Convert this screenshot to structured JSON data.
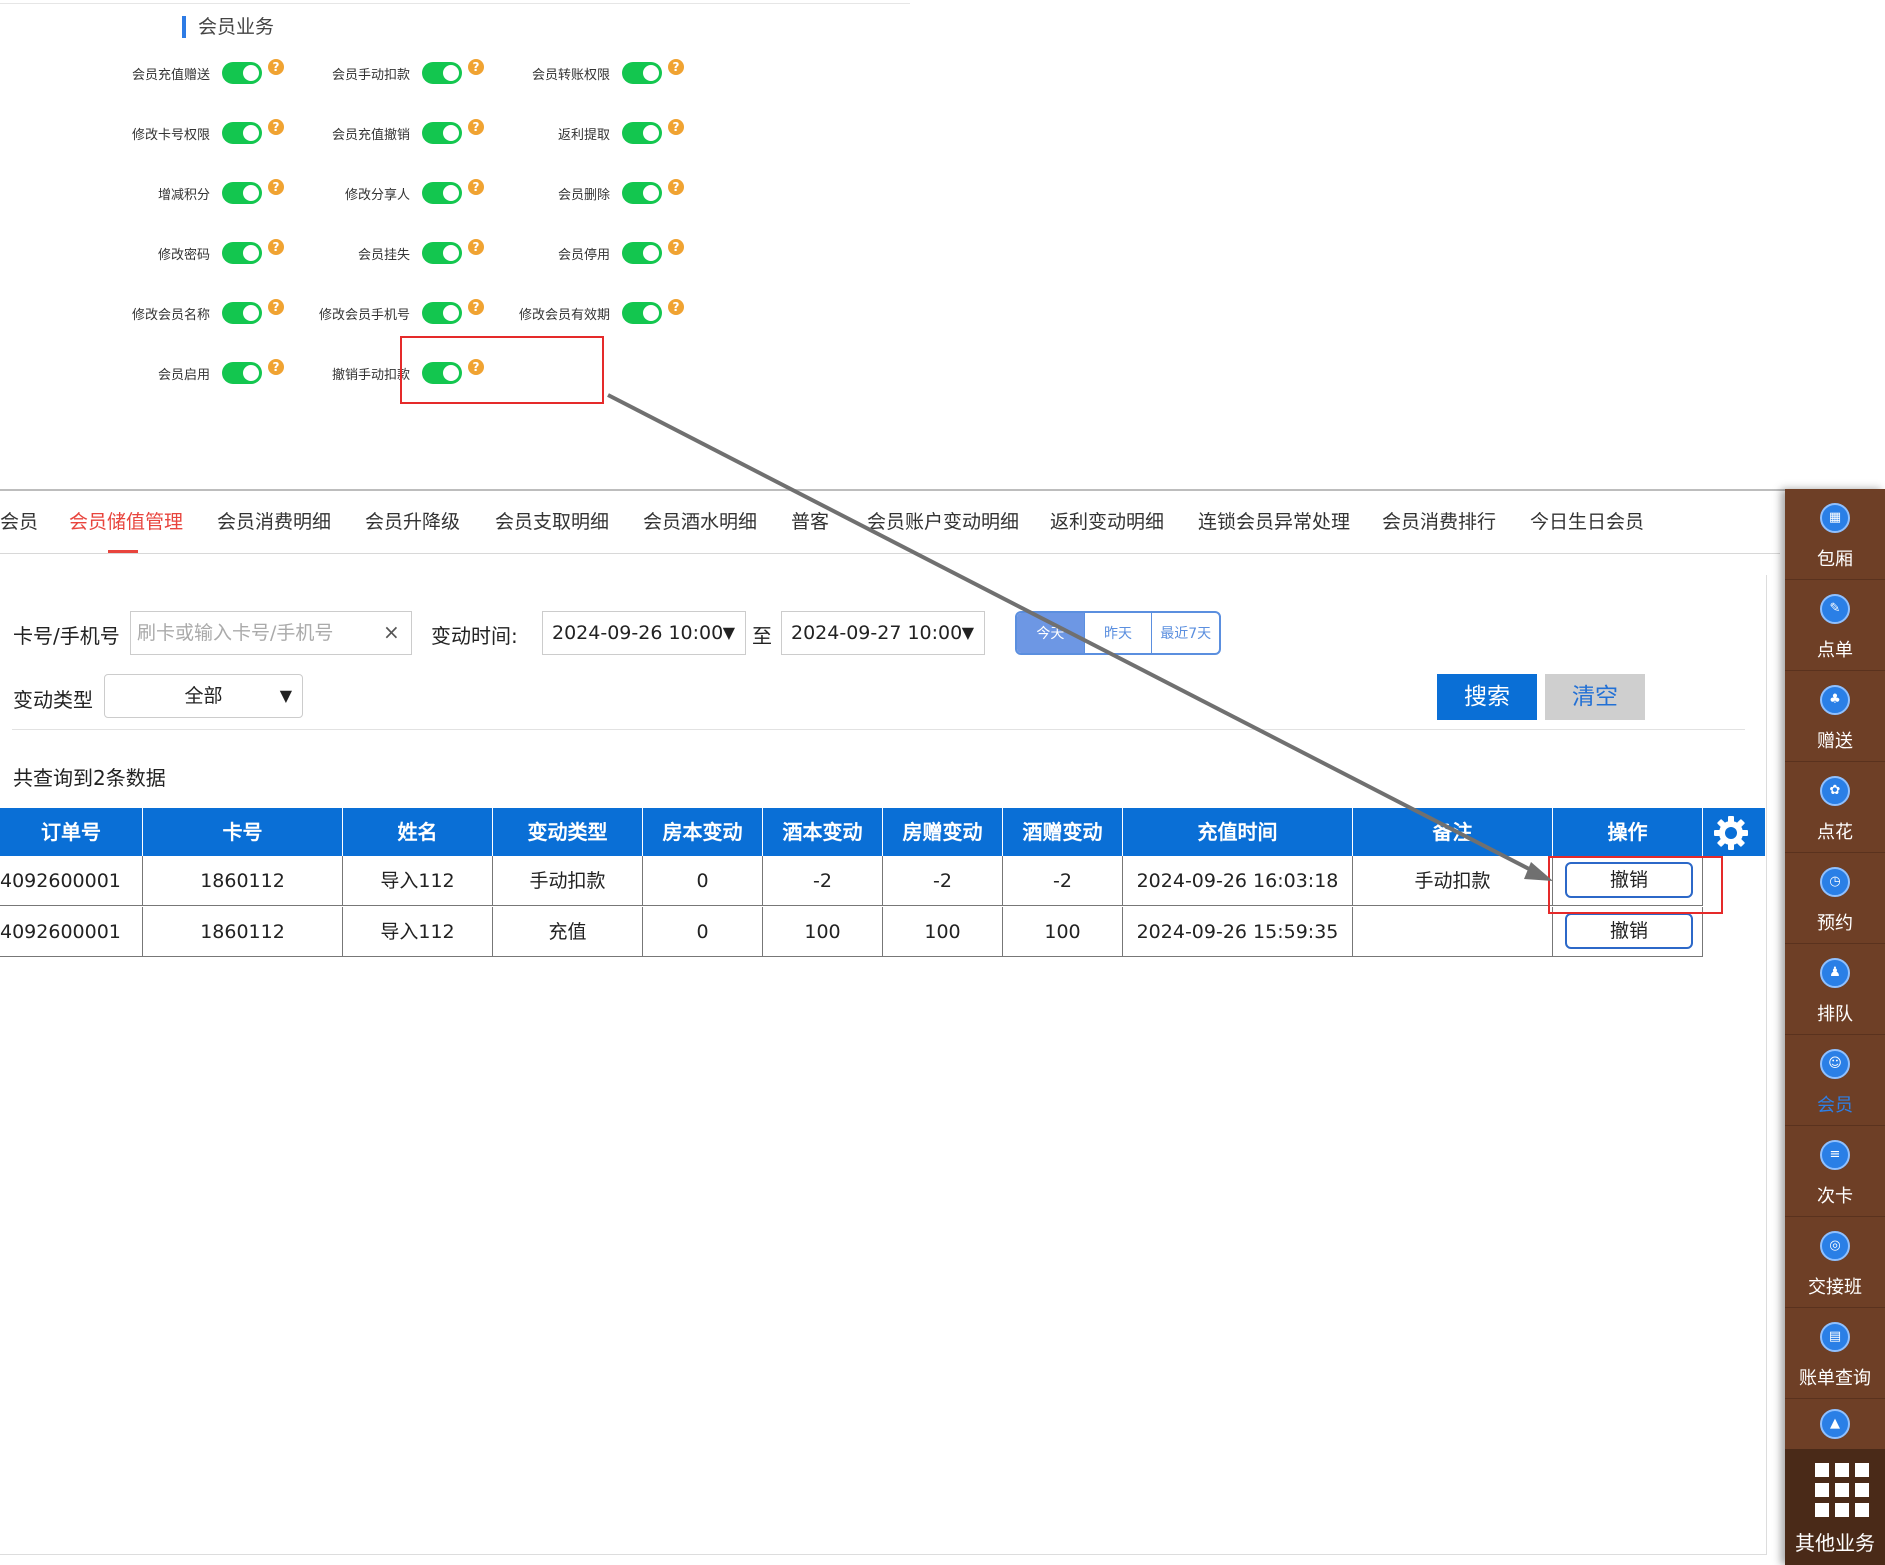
{
  "permission_panel": {
    "title": "会员业务",
    "items": [
      {
        "label": "会员充值赠送",
        "enabled": true
      },
      {
        "label": "会员手动扣款",
        "enabled": true
      },
      {
        "label": "会员转账权限",
        "enabled": true
      },
      {
        "label": "修改卡号权限",
        "enabled": true
      },
      {
        "label": "会员充值撤销",
        "enabled": true
      },
      {
        "label": "返利提取",
        "enabled": true
      },
      {
        "label": "增减积分",
        "enabled": true
      },
      {
        "label": "修改分享人",
        "enabled": true
      },
      {
        "label": "会员删除",
        "enabled": true
      },
      {
        "label": "修改密码",
        "enabled": true
      },
      {
        "label": "会员挂失",
        "enabled": true
      },
      {
        "label": "会员停用",
        "enabled": true
      },
      {
        "label": "修改会员名称",
        "enabled": true
      },
      {
        "label": "修改会员手机号",
        "enabled": true
      },
      {
        "label": "修改会员有效期",
        "enabled": true
      },
      {
        "label": "会员启用",
        "enabled": true
      },
      {
        "label": "撤销手动扣款",
        "enabled": true
      }
    ],
    "help_glyph": "?"
  },
  "tabs": [
    {
      "label": "会员"
    },
    {
      "label": "会员储值管理",
      "active": true
    },
    {
      "label": "会员消费明细"
    },
    {
      "label": "会员升降级"
    },
    {
      "label": "会员支取明细"
    },
    {
      "label": "会员酒水明细"
    },
    {
      "label": "普客"
    },
    {
      "label": "会员账户变动明细"
    },
    {
      "label": "返利变动明细"
    },
    {
      "label": "连锁会员异常处理"
    },
    {
      "label": "会员消费排行"
    },
    {
      "label": "今日生日会员"
    }
  ],
  "filters": {
    "card_label": "卡号/手机号",
    "card_value": "",
    "card_placeholder": "刷卡或输入卡号/手机号",
    "clear_glyph": "×",
    "time_label": "变动时间:",
    "time_from": "2024-09-26 10:00",
    "time_to_sep": "至",
    "time_to": "2024-09-27 10:00",
    "dropdown_glyph": "▼",
    "quick_dates": [
      {
        "label": "今天",
        "active": true
      },
      {
        "label": "昨天"
      },
      {
        "label": "最近7天"
      }
    ],
    "type_label": "变动类型",
    "type_value": "全部",
    "search_label": "搜索",
    "clear_label": "清空"
  },
  "result_count_text": "共查询到2条数据",
  "table": {
    "columns": [
      "订单号",
      "卡号",
      "姓名",
      "变动类型",
      "房本变动",
      "酒本变动",
      "房赠变动",
      "酒赠变动",
      "充值时间",
      "备注",
      "操作"
    ],
    "rows": [
      {
        "order": "4092600001",
        "card": "1860112",
        "name": "导入112",
        "type": "手动扣款",
        "room": "0",
        "drink": "-2",
        "room_gift": "-2",
        "drink_gift": "-2",
        "time": "2024-09-26 16:03:18",
        "remark": "手动扣款",
        "action": "撤销"
      },
      {
        "order": "4092600001",
        "card": "1860112",
        "name": "导入112",
        "type": "充值",
        "room": "0",
        "drink": "100",
        "room_gift": "100",
        "drink_gift": "100",
        "time": "2024-09-26 15:59:35",
        "remark": "",
        "action": "撤销"
      }
    ]
  },
  "sidebar": {
    "items": [
      {
        "label": "包厢",
        "icon": "grid-icon"
      },
      {
        "label": "点单",
        "icon": "order-icon"
      },
      {
        "label": "赠送",
        "icon": "gift-icon"
      },
      {
        "label": "点花",
        "icon": "flower-icon"
      },
      {
        "label": "预约",
        "icon": "reserve-icon"
      },
      {
        "label": "排队",
        "icon": "queue-icon"
      },
      {
        "label": "会员",
        "icon": "member-icon",
        "active": true
      },
      {
        "label": "次卡",
        "icon": "card-icon"
      },
      {
        "label": "交接班",
        "icon": "shift-icon"
      },
      {
        "label": "账单查询",
        "icon": "bill-icon"
      },
      {
        "label": "",
        "icon": "chart-icon"
      }
    ],
    "more_label": "其他业务"
  },
  "colors": {
    "accent_blue": "#0a6fd6",
    "active_tab_red": "#e8443d",
    "toggle_green": "#13c64f",
    "help_orange": "#f0a332",
    "highlight_red": "#e52a2a",
    "sidebar_brown": "#6e3f26"
  }
}
